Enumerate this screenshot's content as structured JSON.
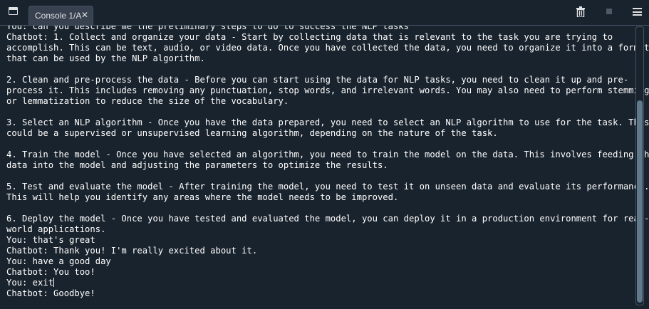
{
  "tab": {
    "label": "Console 1/A",
    "close_glyph": "✕"
  },
  "toolbar": {
    "pane_icon": "pane-icon",
    "clear_icon": "trash-icon",
    "stop_icon": "stop-icon",
    "menu_icon": "hamburger-menu-icon"
  },
  "console": {
    "lines": [
      "You: can you describe me the preliminary steps to do to success the NLP tasks",
      "Chatbot: 1. Collect and organize your data - Start by collecting data that is relevant to the task you are trying to",
      "accomplish. This can be text, audio, or video data. Once you have collected the data, you need to organize it into a format",
      "that can be used by the NLP algorithm.",
      "",
      "2. Clean and pre-process the data - Before you can start using the data for NLP tasks, you need to clean it up and pre-",
      "process it. This includes removing any punctuation, stop words, and irrelevant words. You may also need to perform stemming",
      "or lemmatization to reduce the size of the vocabulary.",
      "",
      "3. Select an NLP algorithm - Once you have the data prepared, you need to select an NLP algorithm to use for the task. This",
      "could be a supervised or unsupervised learning algorithm, depending on the nature of the task.",
      "",
      "4. Train the model - Once you have selected an algorithm, you need to train the model on the data. This involves feeding the",
      "data into the model and adjusting the parameters to optimize the results.",
      "",
      "5. Test and evaluate the model - After training the model, you need to test it on unseen data and evaluate its performance.",
      "This will help you identify any areas where the model needs to be improved.",
      "",
      "6. Deploy the model - Once you have tested and evaluated the model, you can deploy it in a production environment for real-",
      "world applications.",
      "You: that's great",
      "Chatbot: Thank you! I'm really excited about it.",
      "You: have a good day",
      "Chatbot: You too!",
      "You: exit",
      "Chatbot: Goodbye!"
    ]
  },
  "colors": {
    "background": "#19232d",
    "border": "#455364",
    "tab_background": "#37414f",
    "text": "#ffffff",
    "scroll_thumb": "#60798b"
  }
}
